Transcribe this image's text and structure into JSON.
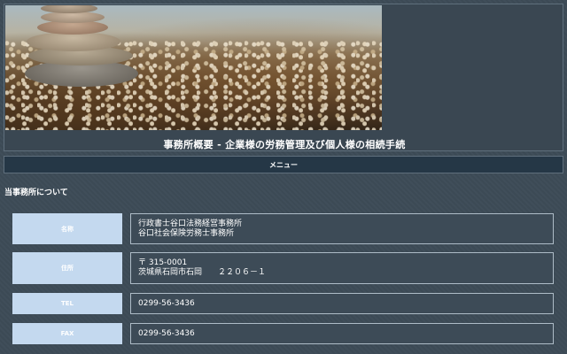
{
  "header": {
    "title": "事務所概要 - 企業様の労務管理及び個人様の相続手続"
  },
  "menu": {
    "label": "メニュー"
  },
  "about": {
    "heading": "当事務所について",
    "rows": [
      {
        "label": "名称",
        "lines": [
          "行政書士谷口法務経営事務所",
          "谷口社会保険労務士事務所"
        ]
      },
      {
        "label": "住所",
        "lines": [
          "〒 315-0001",
          "茨城県石岡市石岡　　２２０６－１"
        ]
      },
      {
        "label": "TEL",
        "lines": [
          "0299-56-3436"
        ]
      },
      {
        "label": "FAX",
        "lines": [
          "0299-56-3436"
        ]
      }
    ]
  },
  "colors": {
    "background": "#3d4b57",
    "menu_bar": "#253746",
    "label_cell": "#c4d9ef"
  }
}
